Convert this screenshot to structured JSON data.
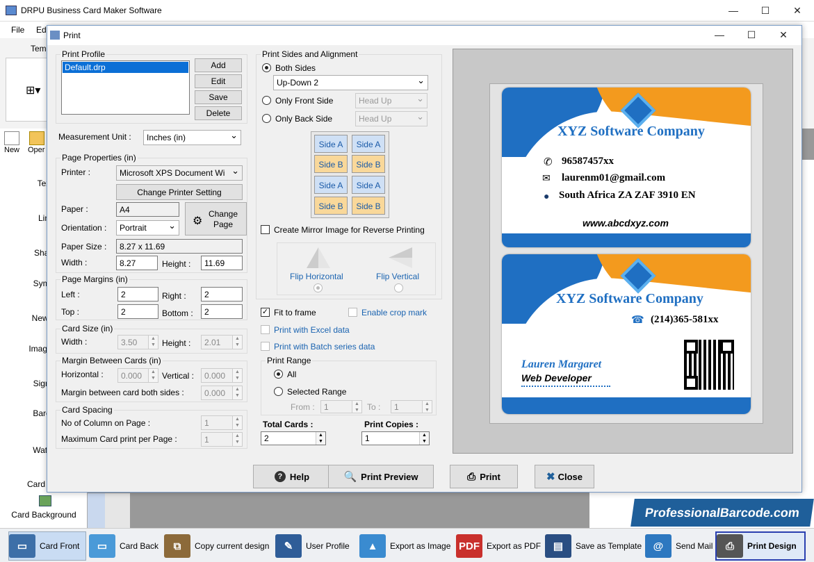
{
  "app": {
    "title": "DRPU Business Card Maker Software"
  },
  "menu": {
    "file": "File",
    "edit_partial": "Ed",
    "tem_partial": "Tem"
  },
  "left_panel": {
    "new": "New",
    "open": "Oper",
    "items": [
      "Tex",
      "Lin",
      "Shap",
      "Symb",
      "New Ir",
      "Image L",
      "Signa",
      "Barco",
      "Water",
      "Card Pro",
      "Card Background"
    ]
  },
  "dialog": {
    "title": "Print",
    "print_profile": {
      "title": "Print Profile",
      "items": [
        "Default.drp"
      ],
      "add": "Add",
      "edit": "Edit",
      "save": "Save",
      "delete": "Delete"
    },
    "measurement_unit": {
      "label": "Measurement Unit :",
      "value": "Inches (in)"
    },
    "page_properties": {
      "title": "Page Properties (in)",
      "printer_label": "Printer :",
      "printer_value": "Microsoft XPS Document Wi",
      "change_printer": "Change Printer Setting",
      "paper_label": "Paper :",
      "paper_value": "A4",
      "change_page": "Change Page",
      "orientation_label": "Orientation :",
      "orientation_value": "Portrait",
      "paper_size_label": "Paper Size :",
      "paper_size_value": "8.27 x 11.69",
      "width_label": "Width :",
      "width_value": "8.27",
      "height_label": "Height :",
      "height_value": "11.69"
    },
    "page_margins": {
      "title": "Page Margins (in)",
      "left_label": "Left :",
      "left": "2",
      "right_label": "Right :",
      "right": "2",
      "top_label": "Top :",
      "top": "2",
      "bottom_label": "Bottom :",
      "bottom": "2"
    },
    "card_size": {
      "title": "Card Size (in)",
      "width_label": "Width :",
      "width": "3.50",
      "height_label": "Height :",
      "height": "2.01"
    },
    "margin_between": {
      "title": "Margin Between Cards (in)",
      "horizontal_label": "Horizontal :",
      "horizontal": "0.000",
      "vertical_label": "Vertical :",
      "vertical": "0.000",
      "both_label": "Margin between card both sides :",
      "both": "0.000"
    },
    "card_spacing": {
      "title": "Card Spacing",
      "columns_label": "No of Column on Page :",
      "columns": "1",
      "max_label": "Maximum Card print per Page :",
      "max": "1"
    },
    "print_sides": {
      "title": "Print Sides and Alignment",
      "both_sides": "Both Sides",
      "both_value": "Up-Down 2",
      "front_only": "Only Front Side",
      "front_value": "Head Up",
      "back_only": "Only Back Side",
      "back_value": "Head Up",
      "grid": [
        "Side A",
        "Side A",
        "Side B",
        "Side B",
        "Side A",
        "Side A",
        "Side B",
        "Side B"
      ],
      "mirror": "Create Mirror Image for Reverse Printing",
      "flip_h": "Flip Horizontal",
      "flip_v": "Flip Vertical"
    },
    "options": {
      "fit": "Fit to frame",
      "crop": "Enable crop mark",
      "excel": "Print with Excel data",
      "batch": "Print with Batch series data"
    },
    "print_range": {
      "title": "Print Range",
      "all": "All",
      "selected": "Selected Range",
      "from_label": "From :",
      "from": "1",
      "to_label": "To :",
      "to": "1"
    },
    "total_cards": {
      "label": "Total Cards :",
      "value": "2"
    },
    "print_copies": {
      "label": "Print Copies :",
      "value": "1"
    },
    "buttons": {
      "help": "Help",
      "preview": "Print Preview",
      "print": "Print",
      "close": "Close"
    }
  },
  "card_front": {
    "company": "XYZ Software Company",
    "phone": "96587457xx",
    "email": "laurenm01@gmail.com",
    "address": "South Africa ZA ZAF 3910 EN",
    "website": "www.abcdxyz.com"
  },
  "card_back": {
    "company": "XYZ Software Company",
    "phone": "(214)365-581xx",
    "name": "Lauren Margaret",
    "role": "Web Developer"
  },
  "banner": "ProfessionalBarcode.com",
  "bottom_bar": [
    "Card Front",
    "Card Back",
    "Copy current design",
    "User Profile",
    "Export as Image",
    "Export as PDF",
    "Save as Template",
    "Send Mail",
    "Print Design"
  ],
  "colors": {
    "accent_blue": "#1f6fc2",
    "accent_orange": "#f39a1e"
  }
}
